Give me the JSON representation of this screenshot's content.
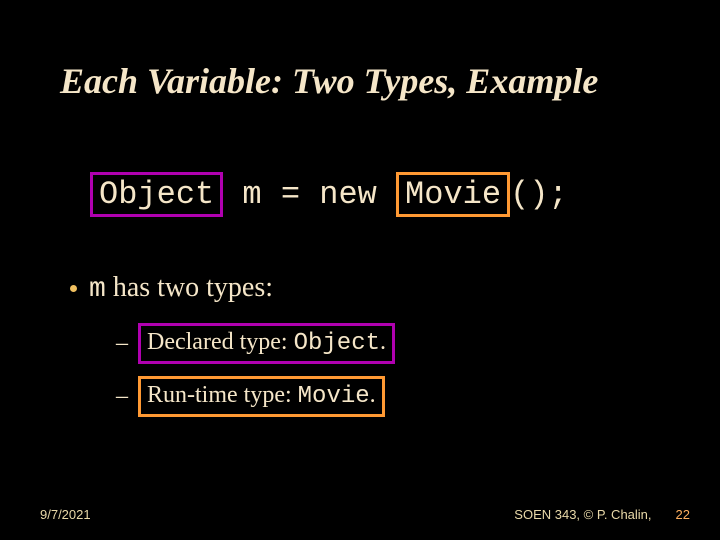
{
  "title": "Each Variable: Two Types, Example",
  "code": {
    "object": "Object",
    "mid": " m = new ",
    "movie": "Movie",
    "tail": "();"
  },
  "bullet": {
    "m": "m",
    "text": " has two types:"
  },
  "sub1": {
    "pre": "Declared type: ",
    "val": "Object",
    "post": "."
  },
  "sub2": {
    "pre": "Run-time type: ",
    "val": "Movie",
    "post": "."
  },
  "footer": {
    "date": "9/7/2021",
    "course": "SOEN 343, © P. Chalin,",
    "page": "22"
  }
}
